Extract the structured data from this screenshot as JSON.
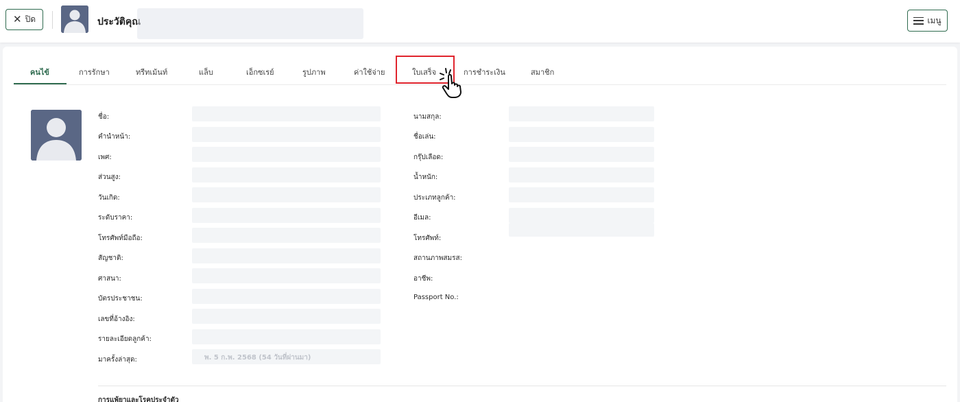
{
  "header": {
    "close_label": "ปิด",
    "title": "ประวัติคุณ",
    "menu_label": "เมนู"
  },
  "tabs": [
    {
      "label": "คนไข้",
      "active": true
    },
    {
      "label": "การรักษา"
    },
    {
      "label": "ทรีทเม้นท์"
    },
    {
      "label": "แล็บ"
    },
    {
      "label": "เอ็กซเรย์"
    },
    {
      "label": "รูปภาพ"
    },
    {
      "label": "ค่าใช้จ่าย"
    },
    {
      "label": "ใบเสร็จ",
      "highlighted": true
    },
    {
      "label": "การชำระเงิน"
    },
    {
      "label": "สมาชิก"
    }
  ],
  "profile": {
    "left_fields": [
      {
        "label": "ชื่อ:",
        "value": ""
      },
      {
        "label": "คำนำหน้า:",
        "value": ""
      },
      {
        "label": "เพศ:",
        "value": ""
      },
      {
        "label": "ส่วนสูง:",
        "value": ""
      },
      {
        "label": "วันเกิด:",
        "value": ""
      },
      {
        "label": "ระดับราคา:",
        "value": ""
      },
      {
        "label": "โทรศัพท์มือถือ:",
        "value": ""
      },
      {
        "label": "สัญชาติ:",
        "value": ""
      },
      {
        "label": "ศาสนา:",
        "value": ""
      },
      {
        "label": "บัตรประชาชน:",
        "value": ""
      },
      {
        "label": "เลขที่อ้างอิง:",
        "value": ""
      },
      {
        "label": "รายละเอียดลูกค้า:",
        "value": ""
      },
      {
        "label": "มาครั้งล่าสุด:",
        "value": "พ. 5 ก.พ. 2568 (54 วันที่ผ่านมา)"
      }
    ],
    "right_fields": [
      {
        "label": "นามสกุล:",
        "value": ""
      },
      {
        "label": "ชื่อเล่น:",
        "value": ""
      },
      {
        "label": "กรุ๊ปเลือด:",
        "value": ""
      },
      {
        "label": "น้ำหนัก:",
        "value": ""
      },
      {
        "label": "ประเภทลูกค้า:",
        "value": ""
      },
      {
        "label": "อีเมล:",
        "value": ""
      },
      {
        "label": "โทรศัพท์:",
        "value": ""
      },
      {
        "label": "สถานภาพสมรส:",
        "value": ""
      },
      {
        "label": "อาชีพ:",
        "value": ""
      },
      {
        "label": "Passport No.:",
        "value": ""
      }
    ]
  },
  "section": {
    "title": "การแพ้ยาและโรคประจำตัว"
  },
  "colors": {
    "accent": "#2f6b4f",
    "highlight": "#e0242d",
    "avatar_bg": "#5a6785"
  }
}
